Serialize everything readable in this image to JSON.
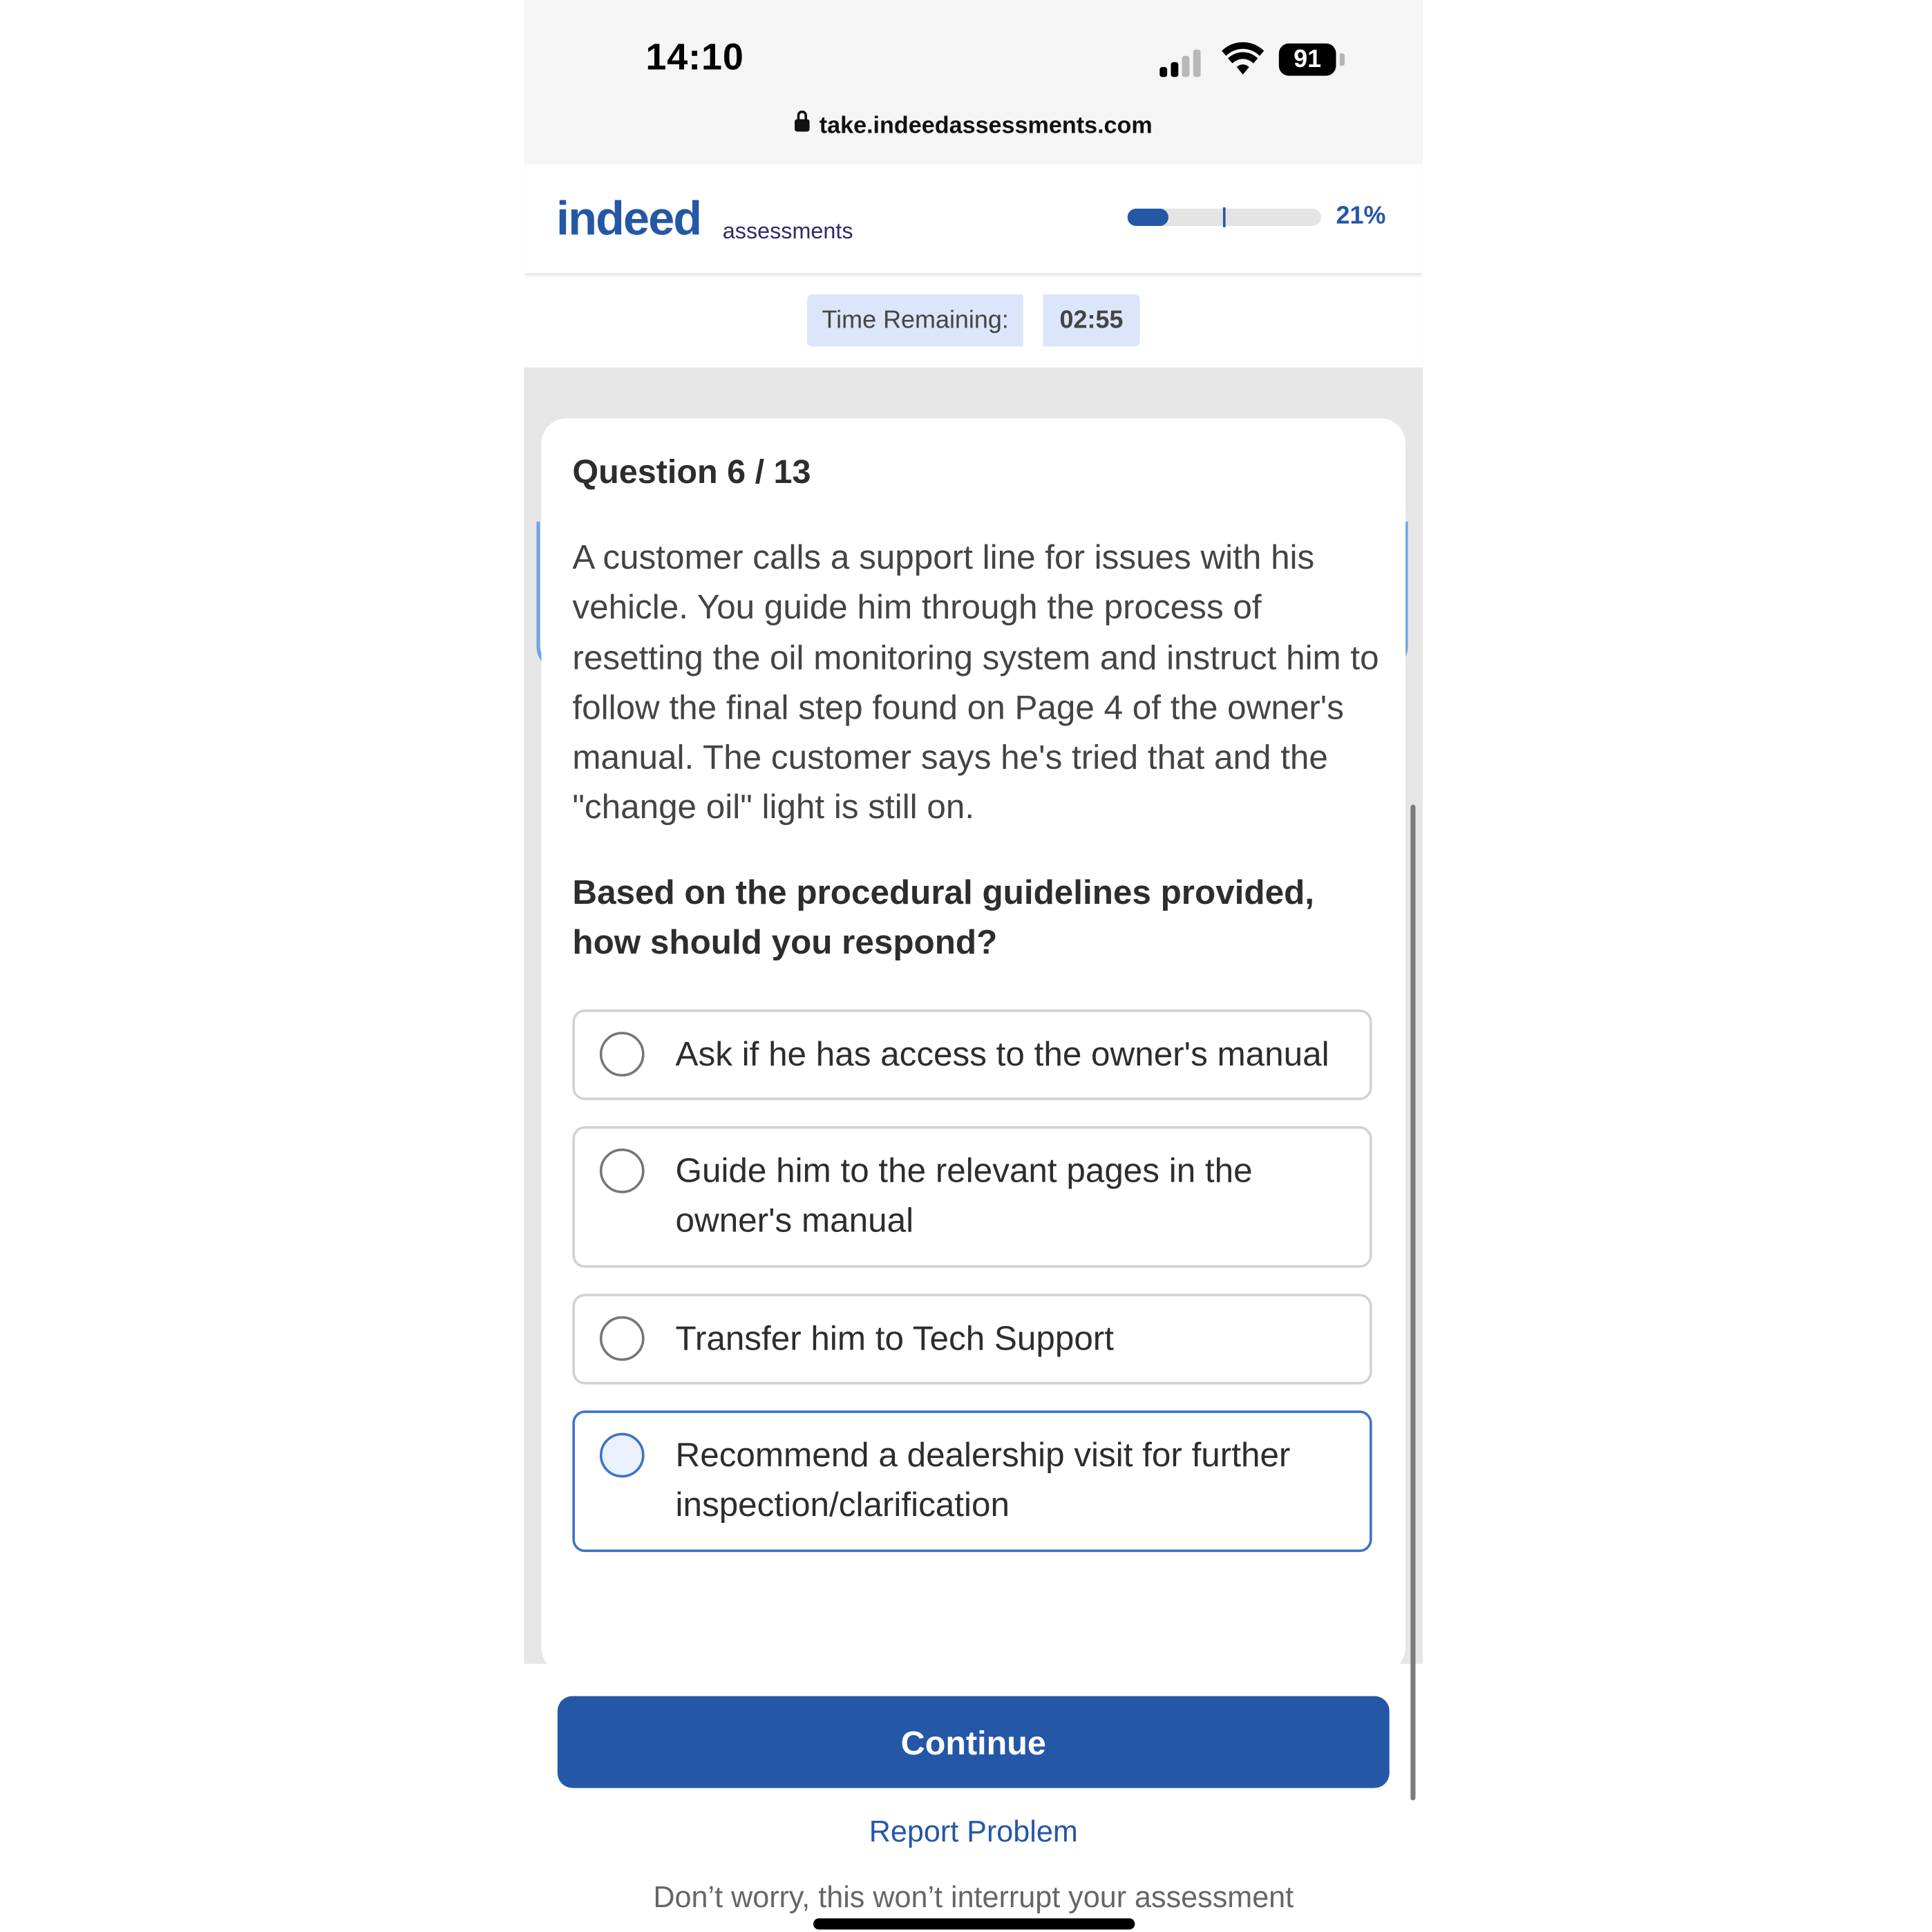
{
  "status_bar": {
    "time": "14:10",
    "battery": "91",
    "url": "take.indeedassessments.com"
  },
  "header": {
    "logo": "indeed",
    "logo_sub": "assessments",
    "progress_percent": 21,
    "progress_label": "21%"
  },
  "timer": {
    "label": "Time Remaining:",
    "value": "02:55"
  },
  "question": {
    "number": "Question 6 / 13",
    "stem": "A customer calls a support line for issues with his vehicle. You guide him through the process of resetting the oil monitoring system and instruct him to follow the final step found on Page 4 of the owner's manual. The customer says he's tried that and the \"change oil\" light is still on.",
    "prompt": "Based on the procedural guidelines provided, how should you respond?",
    "options": [
      {
        "label": "Ask if he has access to the owner's manual",
        "selected": false
      },
      {
        "label": "Guide him to the relevant pages in the owner's manual",
        "selected": false
      },
      {
        "label": "Transfer him to Tech Support",
        "selected": false
      },
      {
        "label": "Recommend a dealership visit for further inspection/clarification",
        "selected": true
      }
    ]
  },
  "footer": {
    "continue_label": "Continue",
    "report_label": "Report Problem",
    "note": "Don’t worry, this won’t interrupt your assessment"
  },
  "colors": {
    "brand": "#2557a7",
    "selected_border": "#3d72c9",
    "timer_bg": "#dde5fb"
  }
}
